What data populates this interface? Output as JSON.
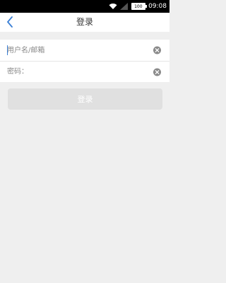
{
  "status_bar": {
    "time": "09:08",
    "battery_level": "100",
    "icons": [
      "wifi-icon",
      "signal-icon",
      "battery-icon"
    ]
  },
  "nav": {
    "title": "登录",
    "back_icon": "chevron-left-icon"
  },
  "form": {
    "username": {
      "value": "",
      "placeholder": "用户名/邮箱"
    },
    "password": {
      "value": "",
      "placeholder": "密码："
    }
  },
  "login_button": {
    "label": "登录"
  },
  "colors": {
    "accent": "#3a7fd5",
    "background": "#efefef",
    "button_disabled": "#e0e0e0"
  }
}
